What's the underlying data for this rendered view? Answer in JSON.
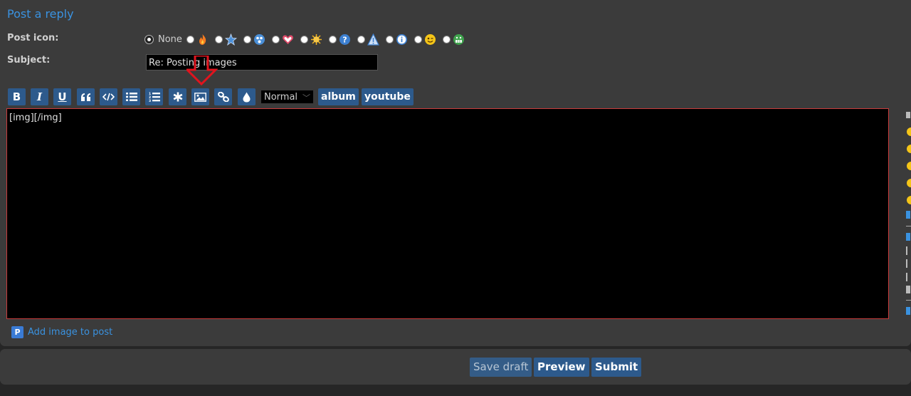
{
  "form": {
    "title": "Post a reply",
    "post_icon_label": "Post icon:",
    "none_label": "None",
    "subject_label": "Subject:",
    "subject_value": "Re: Posting images",
    "icons": [
      "fire-icon",
      "star-icon",
      "shocked-face-icon",
      "heart-icon",
      "sun-icon",
      "question-icon",
      "warning-icon",
      "info-icon",
      "winking-face-icon",
      "grinning-face-icon"
    ]
  },
  "toolbar": {
    "bold": "B",
    "italic": "I",
    "underline": "U",
    "font_size": "Normal",
    "album": "album",
    "youtube": "youtube"
  },
  "editor": {
    "content": "[img][/img]"
  },
  "attach": {
    "label": "Add image to post"
  },
  "actions": {
    "save_draft": "Save draft",
    "preview": "Preview",
    "submit": "Submit"
  },
  "colors": {
    "accent_link": "#3a92e0",
    "button_bg": "#2d5a8c",
    "editor_border": "#c83c3c",
    "annotation_arrow": "#e0141e"
  }
}
